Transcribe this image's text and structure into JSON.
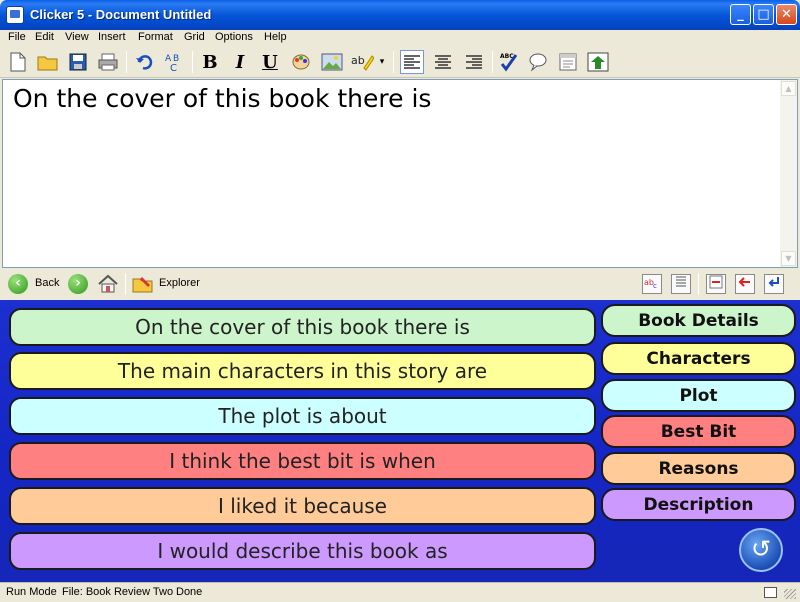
{
  "window": {
    "title": "Clicker 5 - Document Untitled",
    "min": "_",
    "max": "□",
    "close": "✕"
  },
  "menu": [
    "File",
    "Edit",
    "View",
    "Insert",
    "Format",
    "Grid",
    "Options",
    "Help"
  ],
  "toolbar": {
    "bold": "B",
    "italic": "I",
    "underline": "U",
    "abc": "ABC"
  },
  "document": {
    "text": "On the cover of this book there is"
  },
  "nav": {
    "back": "Back",
    "explorer": "Explorer"
  },
  "grid": {
    "cells": [
      {
        "label": "On the cover of this book there is",
        "color": "#ccf5cc"
      },
      {
        "label": "The main characters in this story are",
        "color": "#ffff99"
      },
      {
        "label": "The plot is about",
        "color": "#ccffff"
      },
      {
        "label": "I think the best bit is when",
        "color": "#ff8080"
      },
      {
        "label": "I liked it because",
        "color": "#ffcc99"
      },
      {
        "label": "I would describe this book as",
        "color": "#cc99ff"
      }
    ],
    "tabs": [
      {
        "label": "Book Details",
        "color": "#ccf5cc"
      },
      {
        "label": "Characters",
        "color": "#ffff99"
      },
      {
        "label": "Plot",
        "color": "#ccffff"
      },
      {
        "label": "Best Bit",
        "color": "#ff8080"
      },
      {
        "label": "Reasons",
        "color": "#ffcc99"
      },
      {
        "label": "Description",
        "color": "#cc99ff"
      }
    ]
  },
  "status": {
    "mode": "Run Mode",
    "file": "File: Book Review Two",
    "state": "Done"
  }
}
